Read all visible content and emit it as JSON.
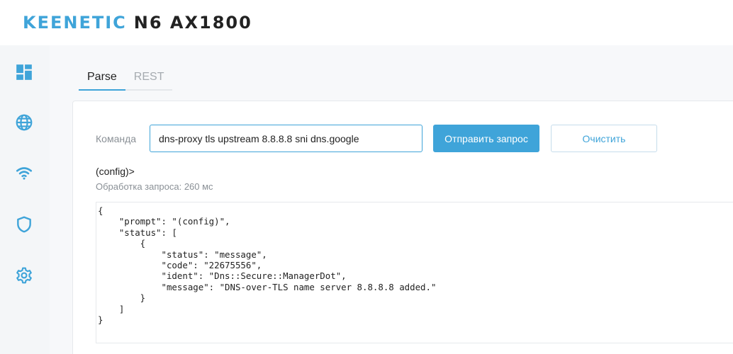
{
  "header": {
    "brand_name": "KEENETIC",
    "brand_model": "N6 AX1800"
  },
  "sidebar": {
    "items": [
      {
        "icon": "dashboard-icon"
      },
      {
        "icon": "globe-icon"
      },
      {
        "icon": "wifi-icon"
      },
      {
        "icon": "shield-icon"
      },
      {
        "icon": "gear-icon"
      }
    ],
    "accent_color": "#3fa4d9"
  },
  "tabs": [
    {
      "label": "Parse",
      "active": true
    },
    {
      "label": "REST",
      "active": false
    }
  ],
  "command": {
    "label": "Команда",
    "value": "dns-proxy tls upstream 8.8.8.8 sni dns.google",
    "send_label": "Отправить запрос",
    "clear_label": "Очистить"
  },
  "result": {
    "prompt": "(config)>",
    "processing": "Обработка запроса: 260 мс",
    "output_lines": [
      "{",
      "    \"prompt\": \"(config)\",",
      "    \"status\": [",
      "        {",
      "            \"status\": \"message\",",
      "            \"code\": \"22675556\",",
      "            \"ident\": \"Dns::Secure::ManagerDot\",",
      "            \"message\": \"DNS-over-TLS name server 8.8.8.8 added.\"",
      "        }",
      "    ]",
      "}"
    ]
  }
}
